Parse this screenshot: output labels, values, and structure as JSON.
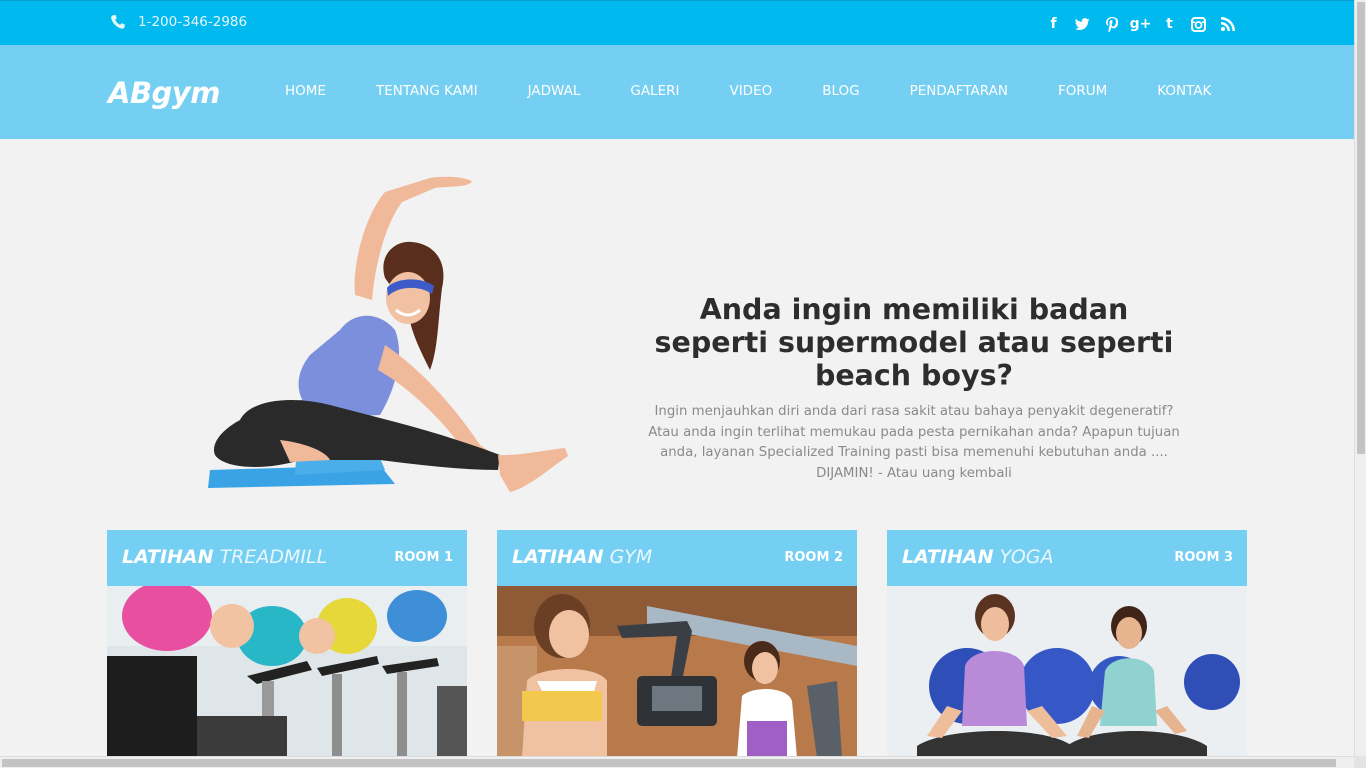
{
  "topbar": {
    "phone": "1-200-346-2986",
    "social": [
      "f",
      "twitter",
      "pinterest",
      "g+",
      "t",
      "instagram",
      "rss"
    ]
  },
  "brand": "ABgym",
  "nav": [
    "HOME",
    "TENTANG KAMI",
    "JADWAL",
    "GALERI",
    "VIDEO",
    "BLOG",
    "PENDAFTARAN",
    "FORUM",
    "KONTAK"
  ],
  "hero": {
    "title": "Anda ingin memiliki badan seperti supermodel atau seperti beach boys?",
    "description": "Ingin menjauhkan diri anda dari rasa sakit atau bahaya penyakit degeneratif? Atau anda ingin terlihat memukau pada pesta pernikahan anda? Apapun tujuan anda, layanan Specialized Training pasti bisa memenuhi kebutuhan anda .... DIJAMIN! - Atau uang kembali"
  },
  "cards": [
    {
      "strong": "LATIHAN",
      "light": "TREADMILL",
      "room": "ROOM 1"
    },
    {
      "strong": "LATIHAN",
      "light": "GYM",
      "room": "ROOM 2"
    },
    {
      "strong": "LATIHAN",
      "light": "YOGA",
      "room": "ROOM 3"
    }
  ],
  "colors": {
    "topbar": "#00b9ef",
    "navbar": "#74cff3",
    "background": "#f2f2f2",
    "heading": "#2d2d2d"
  }
}
